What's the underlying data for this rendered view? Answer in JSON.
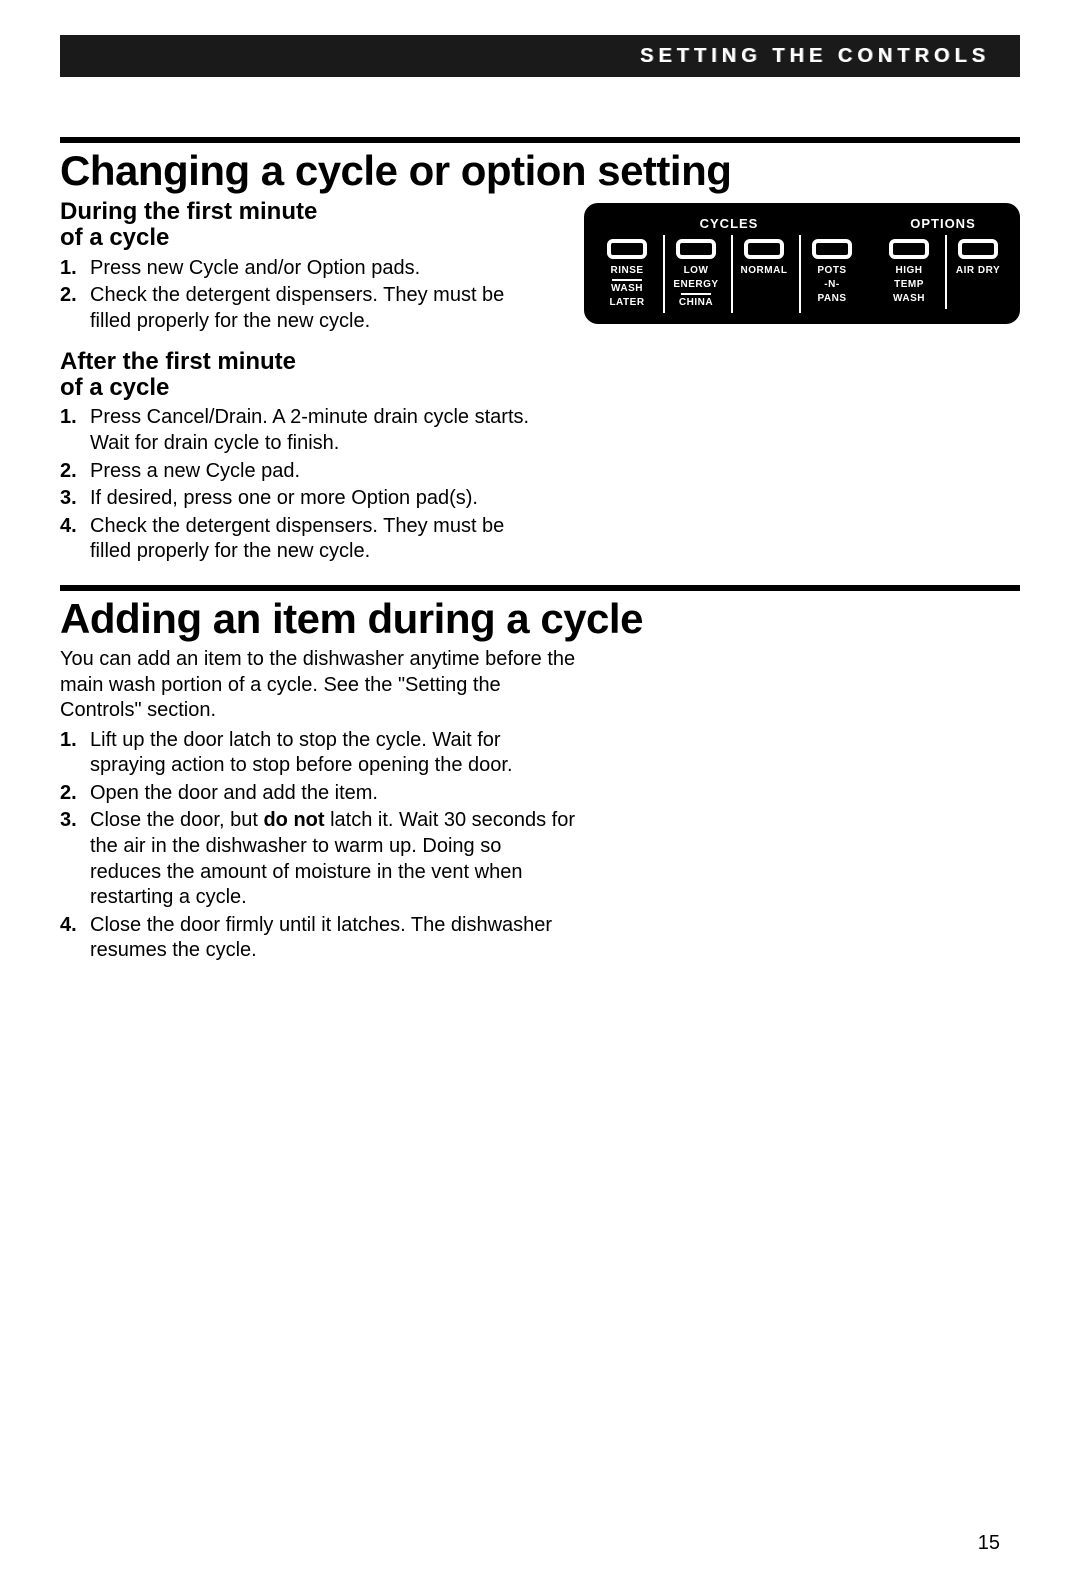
{
  "header": {
    "title": "SETTING THE CONTROLS"
  },
  "section1": {
    "title": "Changing a cycle or option setting",
    "sub1": {
      "line1": "During the first minute",
      "line2": "of a cycle"
    },
    "list1": [
      {
        "n": "1.",
        "t": "Press new Cycle and/or Option pads."
      },
      {
        "n": "2.",
        "t": "Check the detergent dispensers. They must be filled properly for the new cycle."
      }
    ],
    "sub2": {
      "line1": "After the first minute",
      "line2": "of a cycle"
    },
    "list2": [
      {
        "n": "1.",
        "t": "Press Cancel/Drain. A 2-minute drain cycle starts. Wait for drain cycle to finish."
      },
      {
        "n": "2.",
        "t": "Press a new Cycle pad."
      },
      {
        "n": "3.",
        "t": "If desired, press one or more Option pad(s)."
      },
      {
        "n": "4.",
        "t": "Check the detergent dispensers. They must be filled properly for the new cycle."
      }
    ]
  },
  "panel": {
    "cycles_title": "CYCLES",
    "options_title": "OPTIONS",
    "cycles": [
      {
        "lines": [
          "RINSE",
          "—",
          "WASH",
          "LATER"
        ]
      },
      {
        "lines": [
          "LOW",
          "ENERGY",
          "—",
          "CHINA"
        ]
      },
      {
        "lines": [
          "NORMAL"
        ]
      },
      {
        "lines": [
          "POTS",
          "-N-",
          "PANS"
        ]
      }
    ],
    "options": [
      {
        "lines": [
          "HIGH",
          "TEMP",
          "WASH"
        ]
      },
      {
        "lines": [
          "AIR DRY"
        ]
      }
    ]
  },
  "section2": {
    "title": "Adding an item during a cycle",
    "intro": "You can add an item to the dishwasher anytime before the main wash portion of a cycle. See the \"Setting the Controls\" section.",
    "list": [
      {
        "n": "1.",
        "t": "Lift up the door latch to stop the cycle. Wait for spraying action to stop before opening the door."
      },
      {
        "n": "2.",
        "t": "Open the door and add the item."
      },
      {
        "n": "3.",
        "pre": "Close the door, but ",
        "bold": "do not",
        "post": " latch it. Wait 30 seconds for the air in the dishwasher to warm up. Doing so reduces the amount of moisture in the vent when restarting a cycle."
      },
      {
        "n": "4.",
        "t": "Close the door firmly until it latches. The dishwasher resumes the cycle."
      }
    ]
  },
  "page_number": "15"
}
